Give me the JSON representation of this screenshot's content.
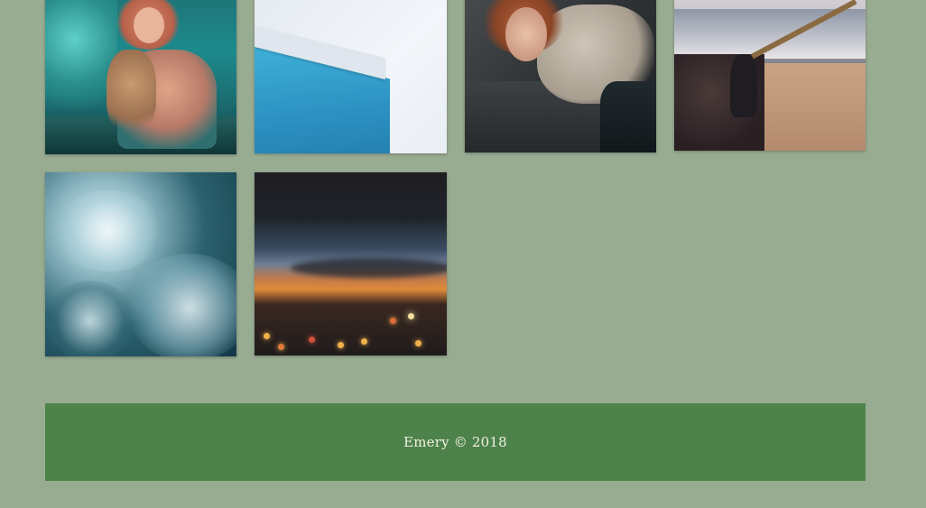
{
  "gallery": {
    "photos": [
      {
        "subject": "christmas-girl-with-dog"
      },
      {
        "subject": "glass-skyscraper"
      },
      {
        "subject": "woman-lying-on-stone"
      },
      {
        "subject": "beach-stairs-sunset"
      },
      {
        "subject": "sea-foam"
      },
      {
        "subject": "blurry-sunset-city-lights"
      }
    ]
  },
  "footer": {
    "text": "Emery © 2018"
  },
  "colors": {
    "page_background": "#98ac92",
    "footer_background": "#4d824a",
    "footer_text": "#f4f1e4"
  }
}
